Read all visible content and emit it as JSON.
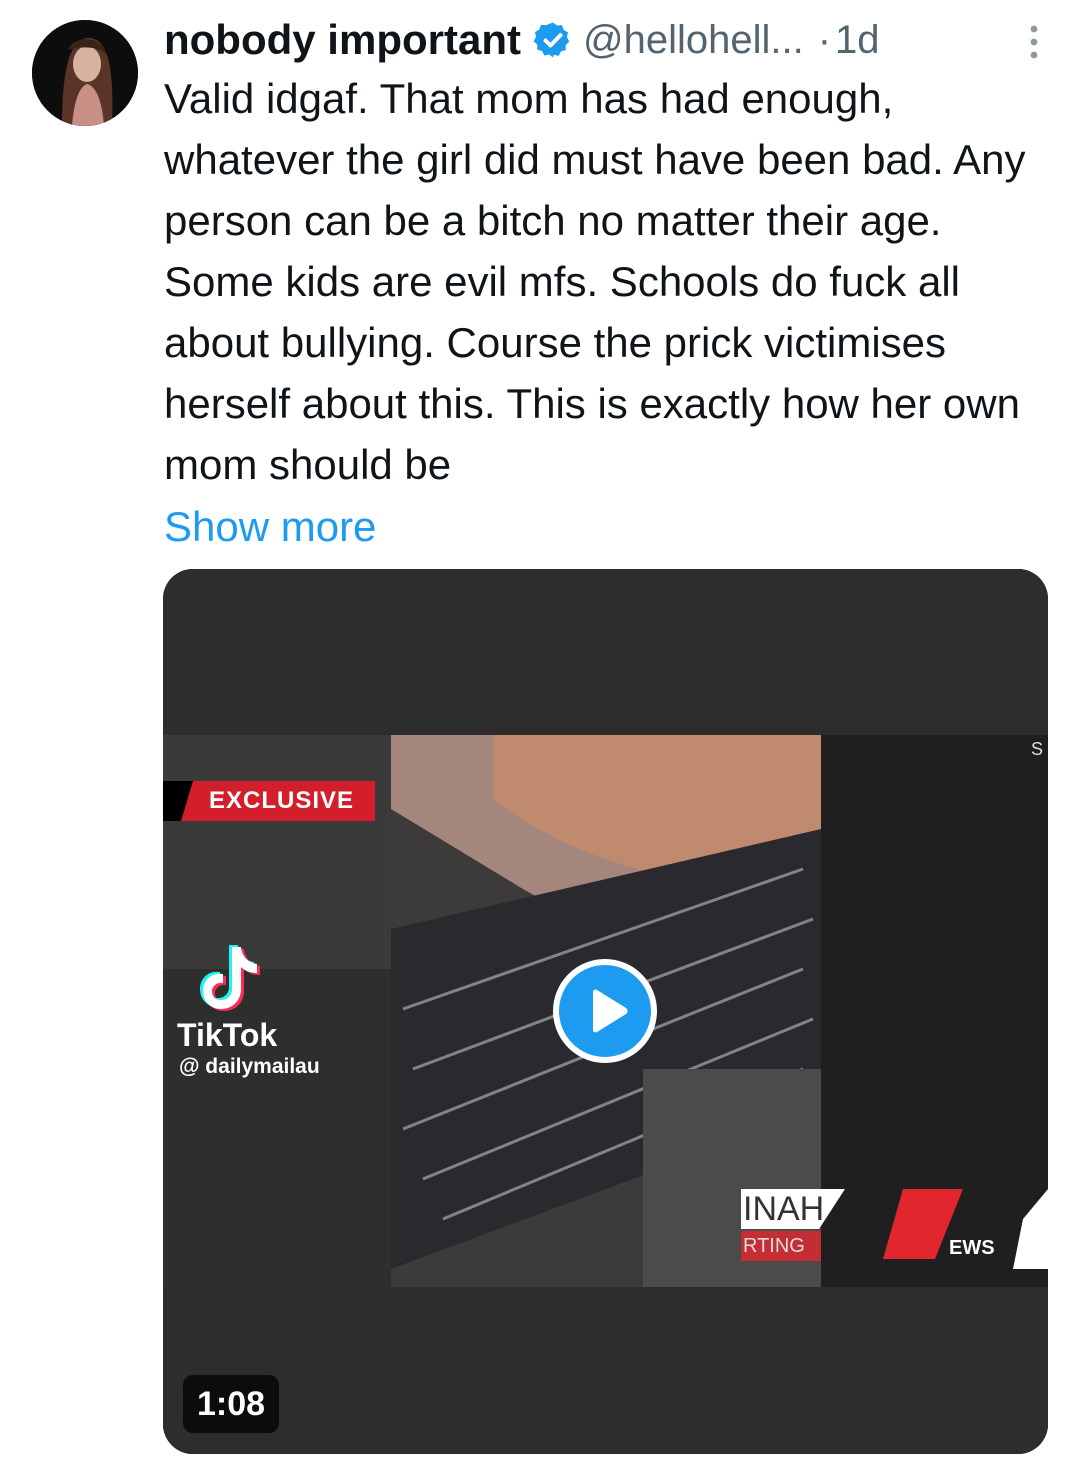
{
  "tweet": {
    "author_name": "nobody important",
    "handle": "@hellohell...",
    "separator": "·",
    "time": "1d",
    "text": "Valid idgaf. That mom has had enough, whatever the girl did must have been bad. Any person can be a bitch no matter their age. Some kids are evil mfs. Schools do fuck all about bullying. Course the prick victimises herself about this. This is exactly how her own mom should be",
    "show_more": "Show more",
    "verified": true
  },
  "media": {
    "type": "video",
    "exclusive_label": "EXCLUSIVE",
    "tiktok_label": "TikTok",
    "tiktok_handle": "@ dailymailau",
    "ticker_top": "INAH",
    "ticker_bottom": "RTING",
    "news_label": "EWS",
    "corner_letter": "S",
    "duration": "1:08"
  },
  "colors": {
    "accent": "#1d9bf0",
    "text": "#0f1419",
    "secondary": "#536471",
    "exclusive_red": "#d21f2b"
  },
  "icons": {
    "verified": "verified-badge-icon",
    "more": "more-vertical-icon",
    "play": "play-icon",
    "tiktok": "tiktok-logo-icon"
  }
}
